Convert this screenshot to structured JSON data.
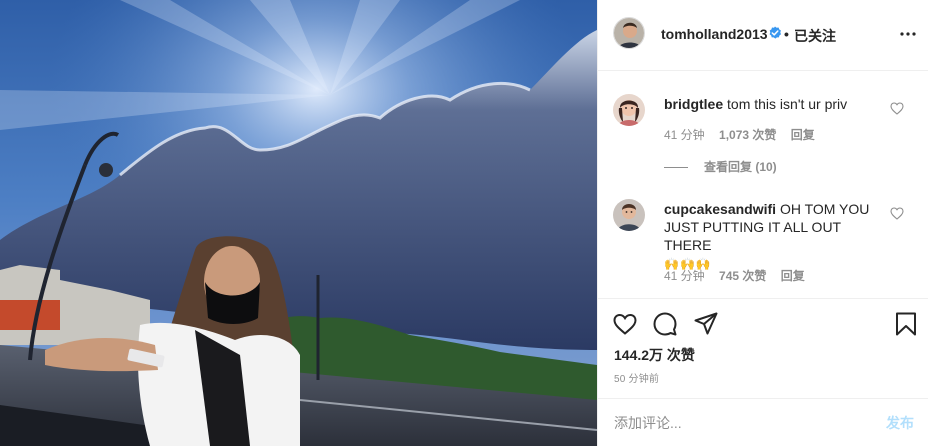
{
  "post": {
    "owner": {
      "username": "tomholland2013",
      "verified_icon": "verified-badge-icon",
      "separator": "•",
      "follow_state": "已关注",
      "more_icon": "more-options-icon"
    },
    "photo_description_icon": "post-photo"
  },
  "comments": [
    {
      "username": "bridgtlee",
      "text": "tom this isn't ur priv",
      "emoji": "",
      "time": "41 分钟",
      "likes": "1,073 次赞",
      "reply_label": "回复",
      "view_replies": "查看回复 (10)"
    },
    {
      "username": "cupcakesandwifi",
      "text": "OH TOM YOU JUST PUTTING IT ALL OUT THERE",
      "emoji": "🙌🙌🙌",
      "time": "41 分钟",
      "likes": "745 次赞",
      "reply_label": "回复"
    }
  ],
  "actions": {
    "like_icon": "heart-icon",
    "comment_icon": "comment-icon",
    "share_icon": "share-icon",
    "save_icon": "bookmark-icon",
    "likes_count": "144.2万 次赞",
    "time_ago": "50 分钟前"
  },
  "composer": {
    "placeholder": "添加评论...",
    "post_label": "发布"
  },
  "colors": {
    "verified": "#3897f0",
    "post_button_disabled": "#b2dffc",
    "muted_text": "#8e8e8e"
  }
}
